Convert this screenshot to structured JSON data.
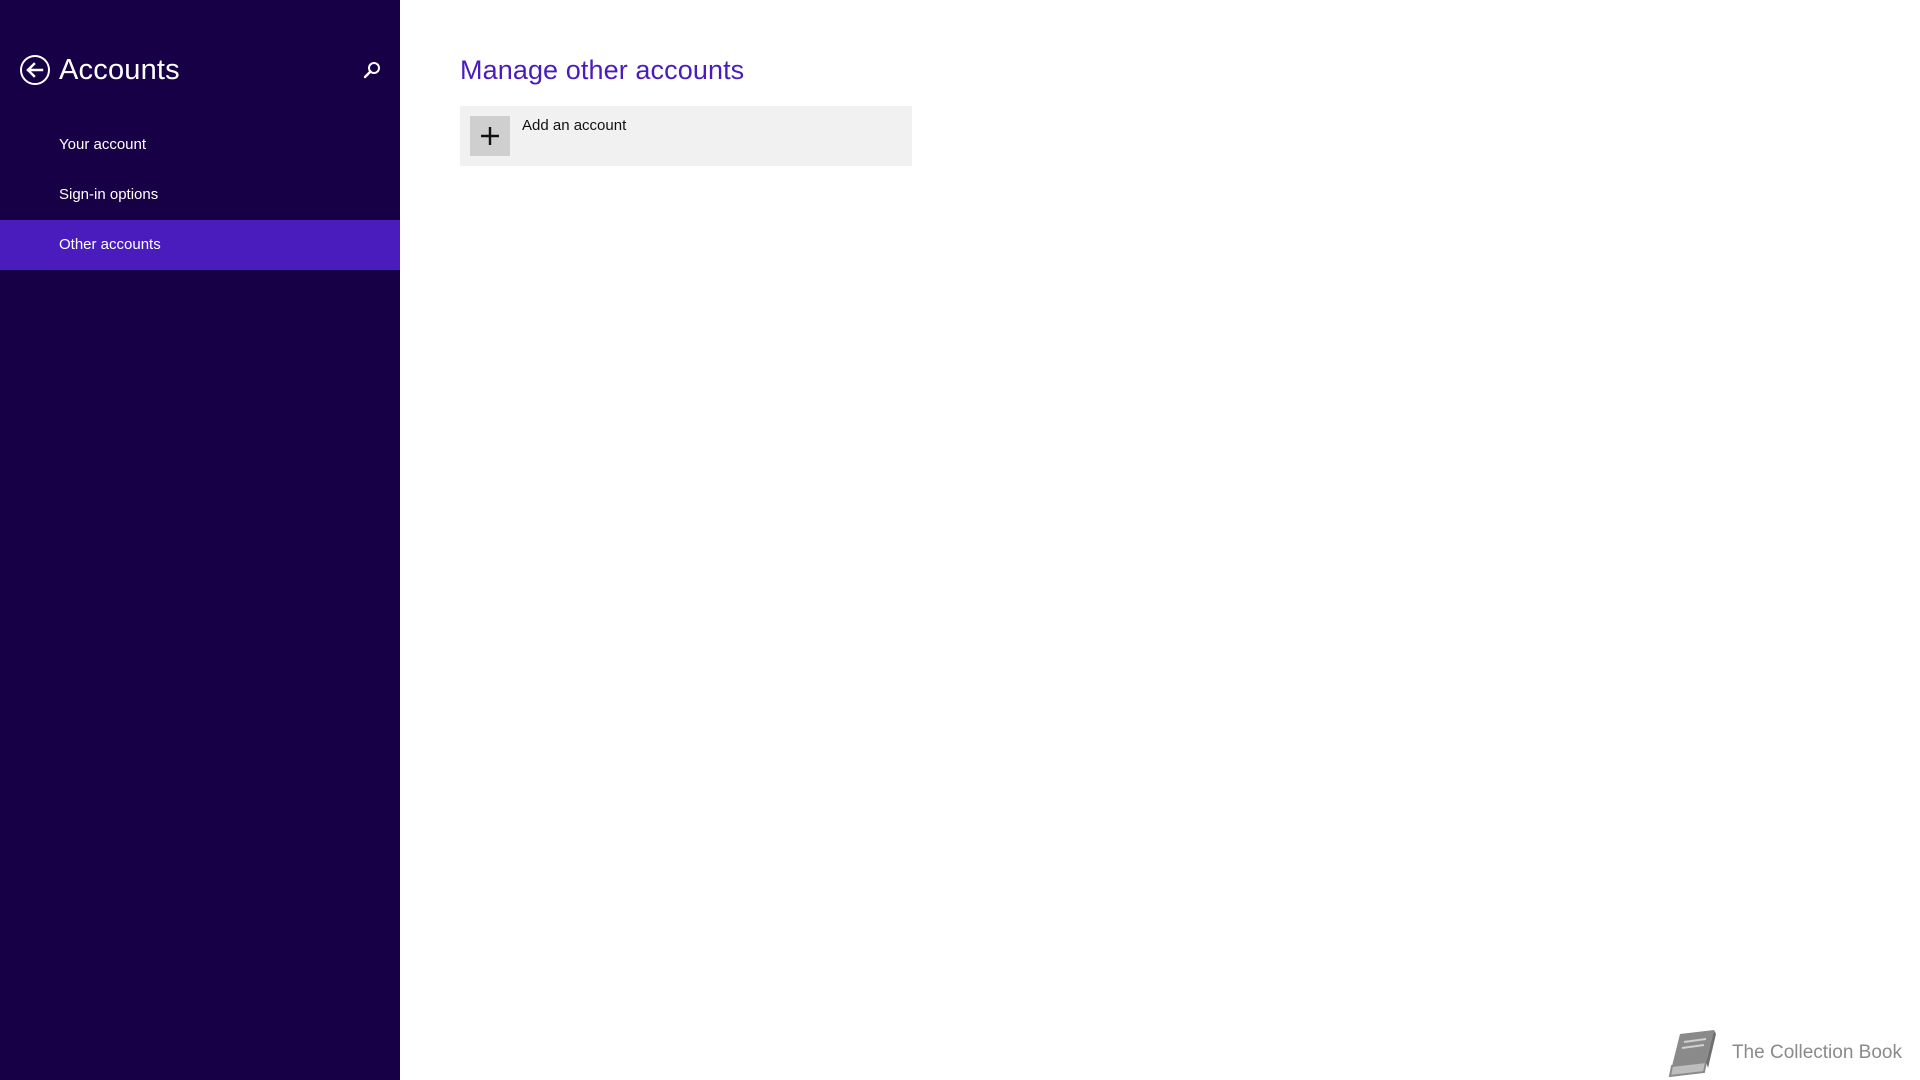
{
  "sidebar": {
    "title": "Accounts",
    "back_icon": "back-arrow-icon",
    "search_icon": "search-icon",
    "items": [
      {
        "label": "Your account",
        "selected": false
      },
      {
        "label": "Sign-in options",
        "selected": false
      },
      {
        "label": "Other accounts",
        "selected": true
      }
    ]
  },
  "main": {
    "title": "Manage other accounts",
    "add_account": {
      "label": "Add an account",
      "icon": "plus-icon"
    }
  },
  "watermark": {
    "text": "The Collection Book",
    "icon": "book-icon"
  },
  "colors": {
    "sidebar_background": "#180046",
    "accent": "#4a1cbe",
    "tile_background": "#f1f1f1",
    "plus_box": "#cfcfcf"
  }
}
